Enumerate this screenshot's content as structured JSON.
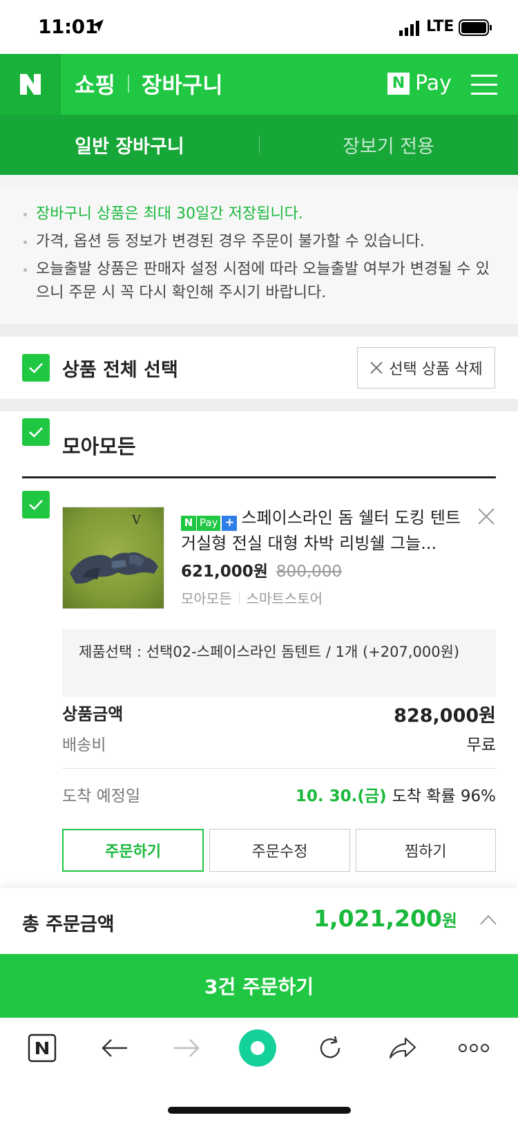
{
  "status_bar": {
    "time": "11:01",
    "network": "LTE"
  },
  "header": {
    "logo": "N",
    "service": "쇼핑",
    "title": "장바구니",
    "npay_logo": "N",
    "npay_label": "Pay"
  },
  "tabs": [
    {
      "label": "일반 장바구니",
      "active": true
    },
    {
      "label": "장보기 전용",
      "active": false
    }
  ],
  "notices": [
    "장바구니 상품은 최대 30일간 저장됩니다.",
    "가격, 옵션 등 정보가 변경된 경우 주문이 불가할 수 있습니다.",
    "오늘출발 상품은 판매자 설정 시점에 따라 오늘출발 여부가 변경될 수 있으니 주문 시 꼭 다시 확인해 주시기 바랍니다."
  ],
  "select_all": {
    "label": "상품 전체 선택",
    "checked": true,
    "delete_label": "선택 상품 삭제"
  },
  "store": {
    "name": "모아모든",
    "checked": true,
    "item": {
      "checked": true,
      "badge_n": "N",
      "badge_pay": "Pay",
      "badge_plus": "+",
      "title": "스페이스라인 돔 쉘터 도킹 텐트 거실형 전실 대형 차박 리빙쉘 그늘...",
      "price": "621,000원",
      "original_price": "800,000",
      "seller": "모아모든",
      "seller_type": "스마트스토어",
      "option": "제품선택 : 선택02-스페이스라인 돔텐트 / 1개 (+207,000원)"
    },
    "summary": {
      "amount_label": "상품금액",
      "amount_value": "828,000원",
      "shipping_label": "배송비",
      "shipping_value": "무료",
      "arrival_label": "도착 예정일",
      "arrival_date": "10. 30.(금)",
      "arrival_prob": "도착 확률 96%"
    },
    "buttons": {
      "order": "주문하기",
      "edit": "주문수정",
      "wish": "찜하기"
    }
  },
  "total": {
    "label": "총 주문금액",
    "amount": "1,021,200",
    "unit": "원"
  },
  "order_button": "3건 주문하기",
  "colors": {
    "brand_green": "#1fc742",
    "tab_green": "#17a638",
    "text_green": "#1ab83b",
    "npay_plus_blue": "#2f7ee6"
  }
}
